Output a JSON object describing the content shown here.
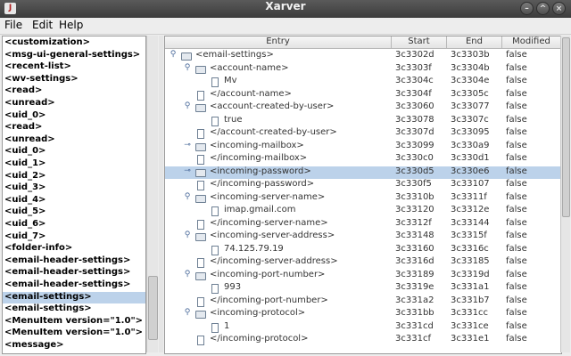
{
  "window": {
    "title": "Xarver",
    "icon": "java-app-icon"
  },
  "menubar": {
    "items": [
      "File",
      "Edit",
      "Help"
    ]
  },
  "left_list": {
    "selected_index": 21,
    "items": [
      "<customization>",
      "<msg-ui-general-settings>",
      "<recent-list>",
      "<wv-settings>",
      "<read>",
      "<unread>",
      "<uid_0>",
      "<read>",
      "<unread>",
      "<uid_0>",
      "<uid_1>",
      "<uid_2>",
      "<uid_3>",
      "<uid_4>",
      "<uid_5>",
      "<uid_6>",
      "<uid_7>",
      "<folder-info>",
      "<email-header-settings>",
      "<email-header-settings>",
      "<email-header-settings>",
      "<email-settings>",
      "<email-settings>",
      "<MenuItem version=\"1.0\">",
      "<MenuItem version=\"1.0\">",
      "<message>"
    ]
  },
  "table": {
    "columns": [
      "Entry",
      "Start",
      "End",
      "Modified"
    ],
    "selected_index": 9,
    "rows": [
      {
        "depth": 0,
        "handle": "open",
        "icon": "folder",
        "entry": "<email-settings>",
        "start": "3c3302d",
        "end": "3c3303b",
        "modified": "false"
      },
      {
        "depth": 1,
        "handle": "open",
        "icon": "folder",
        "entry": "<account-name>",
        "start": "3c3303f",
        "end": "3c3304b",
        "modified": "false"
      },
      {
        "depth": 2,
        "handle": "none",
        "icon": "document",
        "entry": "Mv",
        "start": "3c3304c",
        "end": "3c3304e",
        "modified": "false"
      },
      {
        "depth": 1,
        "handle": "none",
        "icon": "document",
        "entry": "</account-name>",
        "start": "3c3304f",
        "end": "3c3305c",
        "modified": "false"
      },
      {
        "depth": 1,
        "handle": "open",
        "icon": "folder",
        "entry": "<account-created-by-user>",
        "start": "3c33060",
        "end": "3c33077",
        "modified": "false"
      },
      {
        "depth": 2,
        "handle": "none",
        "icon": "document",
        "entry": "true",
        "start": "3c33078",
        "end": "3c3307c",
        "modified": "false"
      },
      {
        "depth": 1,
        "handle": "none",
        "icon": "document",
        "entry": "</account-created-by-user>",
        "start": "3c3307d",
        "end": "3c33095",
        "modified": "false"
      },
      {
        "depth": 1,
        "handle": "closed",
        "icon": "folder",
        "entry": "<incoming-mailbox>",
        "start": "3c33099",
        "end": "3c330a9",
        "modified": "false"
      },
      {
        "depth": 1,
        "handle": "none",
        "icon": "document",
        "entry": "</incoming-mailbox>",
        "start": "3c330c0",
        "end": "3c330d1",
        "modified": "false"
      },
      {
        "depth": 1,
        "handle": "closed",
        "icon": "folder",
        "entry": "<incoming-password>",
        "start": "3c330d5",
        "end": "3c330e6",
        "modified": "false"
      },
      {
        "depth": 1,
        "handle": "none",
        "icon": "document",
        "entry": "</incoming-password>",
        "start": "3c330f5",
        "end": "3c33107",
        "modified": "false"
      },
      {
        "depth": 1,
        "handle": "open",
        "icon": "folder",
        "entry": "<incoming-server-name>",
        "start": "3c3310b",
        "end": "3c3311f",
        "modified": "false"
      },
      {
        "depth": 2,
        "handle": "none",
        "icon": "document",
        "entry": "imap.gmail.com",
        "start": "3c33120",
        "end": "3c3312e",
        "modified": "false"
      },
      {
        "depth": 1,
        "handle": "none",
        "icon": "document",
        "entry": "</incoming-server-name>",
        "start": "3c3312f",
        "end": "3c33144",
        "modified": "false"
      },
      {
        "depth": 1,
        "handle": "open",
        "icon": "folder",
        "entry": "<incoming-server-address>",
        "start": "3c33148",
        "end": "3c3315f",
        "modified": "false"
      },
      {
        "depth": 2,
        "handle": "none",
        "icon": "document",
        "entry": "74.125.79.19",
        "start": "3c33160",
        "end": "3c3316c",
        "modified": "false"
      },
      {
        "depth": 1,
        "handle": "none",
        "icon": "document",
        "entry": "</incoming-server-address>",
        "start": "3c3316d",
        "end": "3c33185",
        "modified": "false"
      },
      {
        "depth": 1,
        "handle": "open",
        "icon": "folder",
        "entry": "<incoming-port-number>",
        "start": "3c33189",
        "end": "3c3319d",
        "modified": "false"
      },
      {
        "depth": 2,
        "handle": "none",
        "icon": "document",
        "entry": "993",
        "start": "3c3319e",
        "end": "3c331a1",
        "modified": "false"
      },
      {
        "depth": 1,
        "handle": "none",
        "icon": "document",
        "entry": "</incoming-port-number>",
        "start": "3c331a2",
        "end": "3c331b7",
        "modified": "false"
      },
      {
        "depth": 1,
        "handle": "open",
        "icon": "folder",
        "entry": "<incoming-protocol>",
        "start": "3c331bb",
        "end": "3c331cc",
        "modified": "false"
      },
      {
        "depth": 2,
        "handle": "none",
        "icon": "document",
        "entry": "1",
        "start": "3c331cd",
        "end": "3c331ce",
        "modified": "false"
      },
      {
        "depth": 1,
        "handle": "none",
        "icon": "document",
        "entry": "</incoming-protocol>",
        "start": "3c331cf",
        "end": "3c331e1",
        "modified": "false"
      }
    ]
  }
}
